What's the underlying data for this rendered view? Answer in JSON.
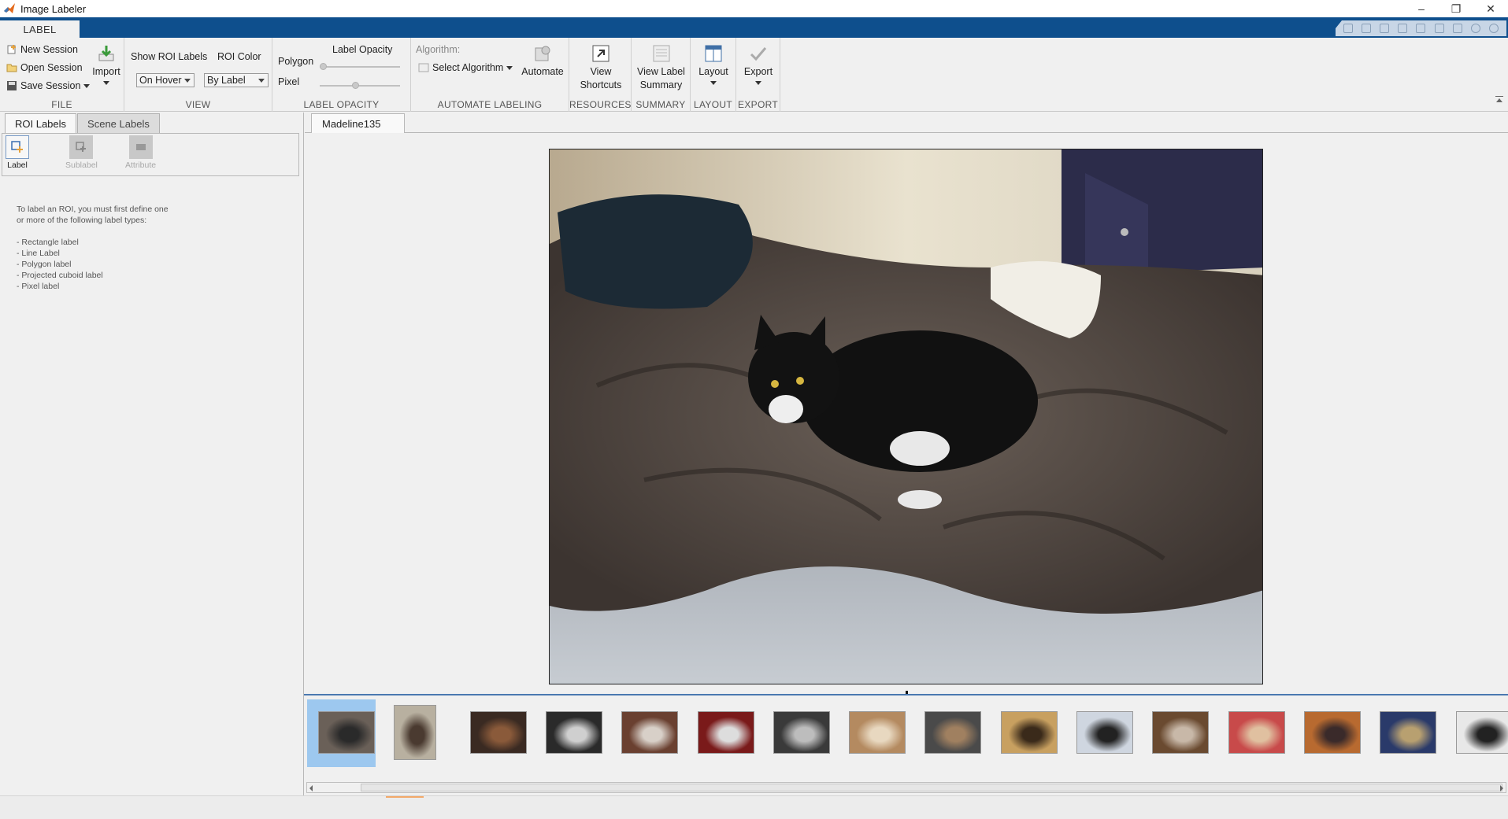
{
  "window": {
    "title": "Image Labeler"
  },
  "ribbon": {
    "tab": "LABEL",
    "file": {
      "label": "FILE",
      "new_session": "New Session",
      "open_session": "Open Session",
      "save_session": "Save Session",
      "import": "Import"
    },
    "view": {
      "label": "VIEW",
      "show_roi_labels": "Show ROI Labels",
      "roi_color": "ROI Color",
      "show_roi_value": "On Hover",
      "roi_color_value": "By Label"
    },
    "label_opacity": {
      "label": "LABEL OPACITY",
      "title": "Label Opacity",
      "polygon": "Polygon",
      "pixel": "Pixel",
      "polygon_opacity": 0.0,
      "pixel_opacity": 0.5
    },
    "automate": {
      "label": "AUTOMATE LABELING",
      "algorithm": "Algorithm:",
      "select_algorithm": "Select Algorithm",
      "automate": "Automate"
    },
    "resources": {
      "label": "RESOURCES",
      "line1": "View",
      "line2": "Shortcuts"
    },
    "summary": {
      "label": "SUMMARY",
      "line1": "View Label",
      "line2": "Summary"
    },
    "layout": {
      "label": "LAYOUT",
      "button": "Layout"
    },
    "export": {
      "label": "EXPORT",
      "button": "Export"
    }
  },
  "left_panel": {
    "tabs": [
      "ROI Labels",
      "Scene Labels"
    ],
    "tools": {
      "label": "Label",
      "sublabel": "Sublabel",
      "attribute": "Attribute"
    },
    "help": "To label an ROI, you must first define one\nor more of the following label types:\n\n- Rectangle label\n- Line Label\n- Polygon label\n- Projected cuboid label\n- Pixel label"
  },
  "document": {
    "tab": "Madeline135"
  },
  "filmstrip": {
    "thumbnail_count": 16,
    "selected_index": 0
  },
  "colors": {
    "ribbon_blue": "#0e4f8d",
    "selection": "#9dc8ef"
  }
}
